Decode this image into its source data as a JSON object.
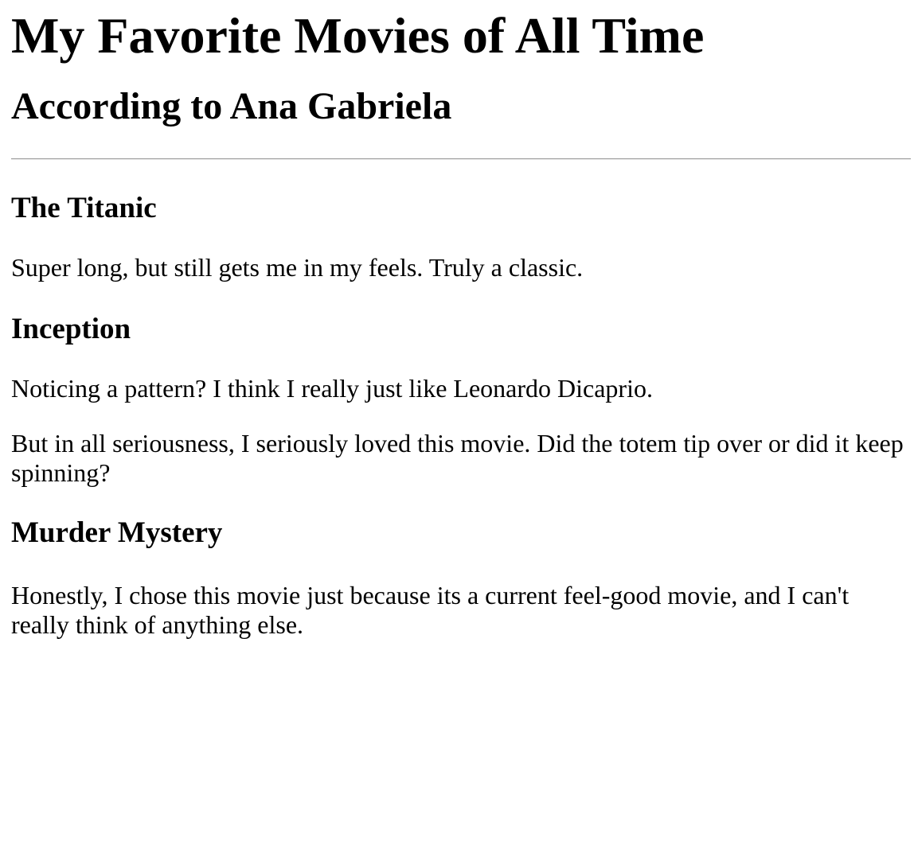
{
  "header": {
    "title": "My Favorite Movies of All Time",
    "subtitle": "According to Ana Gabriela"
  },
  "movies": [
    {
      "title": "The Titanic",
      "paragraphs": [
        "Super long, but still gets me in my feels. Truly a classic."
      ]
    },
    {
      "title": "Inception",
      "paragraphs": [
        "Noticing a pattern? I think I really just like Leonardo Dicaprio.",
        "But in all seriousness, I seriously loved this movie. Did the totem tip over or did it keep spinning?"
      ]
    },
    {
      "title": "Murder Mystery",
      "paragraphs": [
        "Honestly, I chose this movie just because its a current feel-good movie, and I can't really think of anything else."
      ]
    }
  ]
}
